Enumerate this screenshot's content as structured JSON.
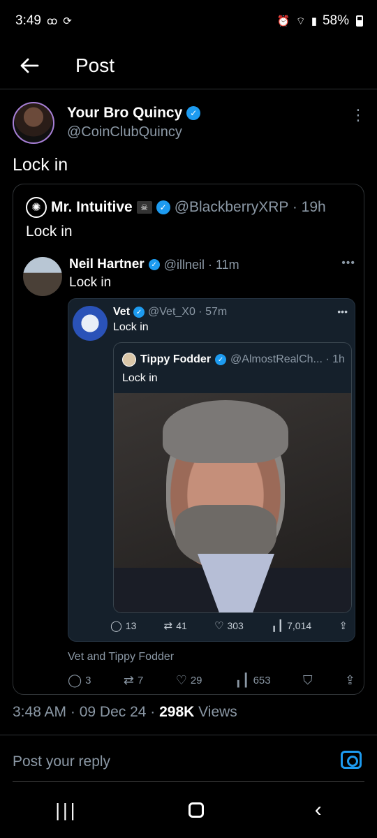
{
  "status_bar": {
    "time": "3:49",
    "voicemail_icon": "voicemail-icon",
    "sync_icon": "sync-icon",
    "alarm_icon": "alarm-icon",
    "wifi_icon": "wifi-icon",
    "signal_icon": "signal-icon",
    "battery": "58%"
  },
  "header": {
    "back_icon": "arrow-left-icon",
    "title": "Post"
  },
  "post": {
    "author_name": "Your Bro Quincy",
    "author_handle": "@CoinClubQuincy",
    "text": "Lock in",
    "timestamp": "3:48 AM · 09 Dec 24 · ",
    "views_count": "298K",
    "views_label": " Views"
  },
  "quote1": {
    "name": "Mr. Intuitive",
    "handle": "@BlackberryXRP · 19h",
    "text": "Lock in"
  },
  "reply": {
    "name": "Neil Hartner",
    "handle": "@illneil · 11m",
    "text": "Lock in"
  },
  "quote2": {
    "name": "Vet",
    "handle": "@Vet_X0 · 57m",
    "text": "Lock in",
    "actions": {
      "replies": "13",
      "reposts": "41",
      "likes": "303",
      "views": "7,014"
    }
  },
  "quote3": {
    "name": "Tippy Fodder",
    "handle": "@AlmostRealCh... · 1h",
    "text": "Lock in"
  },
  "reply_context": "Vet and Tippy Fodder",
  "outer_actions": {
    "replies": "3",
    "reposts": "7",
    "likes": "29",
    "views": "653"
  },
  "reply_bar": {
    "placeholder": "Post your reply"
  },
  "colors": {
    "accent": "#1d9bf0",
    "background": "#000000",
    "muted": "#8b98a5"
  }
}
